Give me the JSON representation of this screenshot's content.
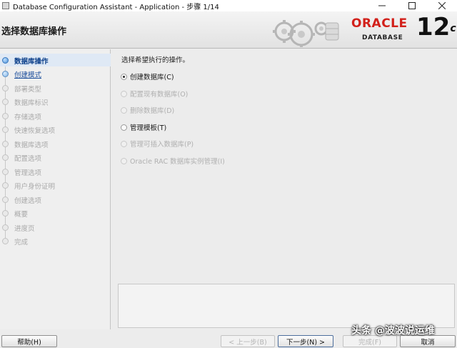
{
  "window": {
    "title": "Database Configuration Assistant - Application - 步骤 1/14",
    "minimize_glyph": "─",
    "maximize_glyph": "☐",
    "close_glyph": "✕"
  },
  "header": {
    "page_title": "选择数据库操作",
    "oracle_word": "ORACLE",
    "database_word": "DATABASE",
    "version_number": "12",
    "version_suffix": "c",
    "brand_color": "#d2201a"
  },
  "steps": [
    {
      "label": "数据库操作",
      "state": "active"
    },
    {
      "label": "创建模式",
      "state": "link"
    },
    {
      "label": "部署类型",
      "state": "disabled"
    },
    {
      "label": "数据库标识",
      "state": "disabled"
    },
    {
      "label": "存储选项",
      "state": "disabled"
    },
    {
      "label": "快速恢复选项",
      "state": "disabled"
    },
    {
      "label": "数据库选项",
      "state": "disabled"
    },
    {
      "label": "配置选项",
      "state": "disabled"
    },
    {
      "label": "管理选项",
      "state": "disabled"
    },
    {
      "label": "用户身份证明",
      "state": "disabled"
    },
    {
      "label": "创建选项",
      "state": "disabled"
    },
    {
      "label": "概要",
      "state": "disabled"
    },
    {
      "label": "进度页",
      "state": "disabled"
    },
    {
      "label": "完成",
      "state": "disabled"
    }
  ],
  "content": {
    "question": "选择希望执行的操作。",
    "options": [
      {
        "label": "创建数据库(C)",
        "checked": true,
        "enabled": true
      },
      {
        "label": "配置现有数据库(O)",
        "checked": false,
        "enabled": false
      },
      {
        "label": "删除数据库(D)",
        "checked": false,
        "enabled": false
      },
      {
        "label": "管理模板(T)",
        "checked": false,
        "enabled": true
      },
      {
        "label": "管理可插入数据库(P)",
        "checked": false,
        "enabled": false
      },
      {
        "label": "Oracle RAC 数据库实例管理(I)",
        "checked": false,
        "enabled": false
      }
    ]
  },
  "buttons": {
    "help": "帮助(H)",
    "back": "< 上一步(B)",
    "next": "下一步(N) >",
    "finish": "完成(F)",
    "cancel": "取消"
  },
  "watermark": "头条 @波波说运维"
}
